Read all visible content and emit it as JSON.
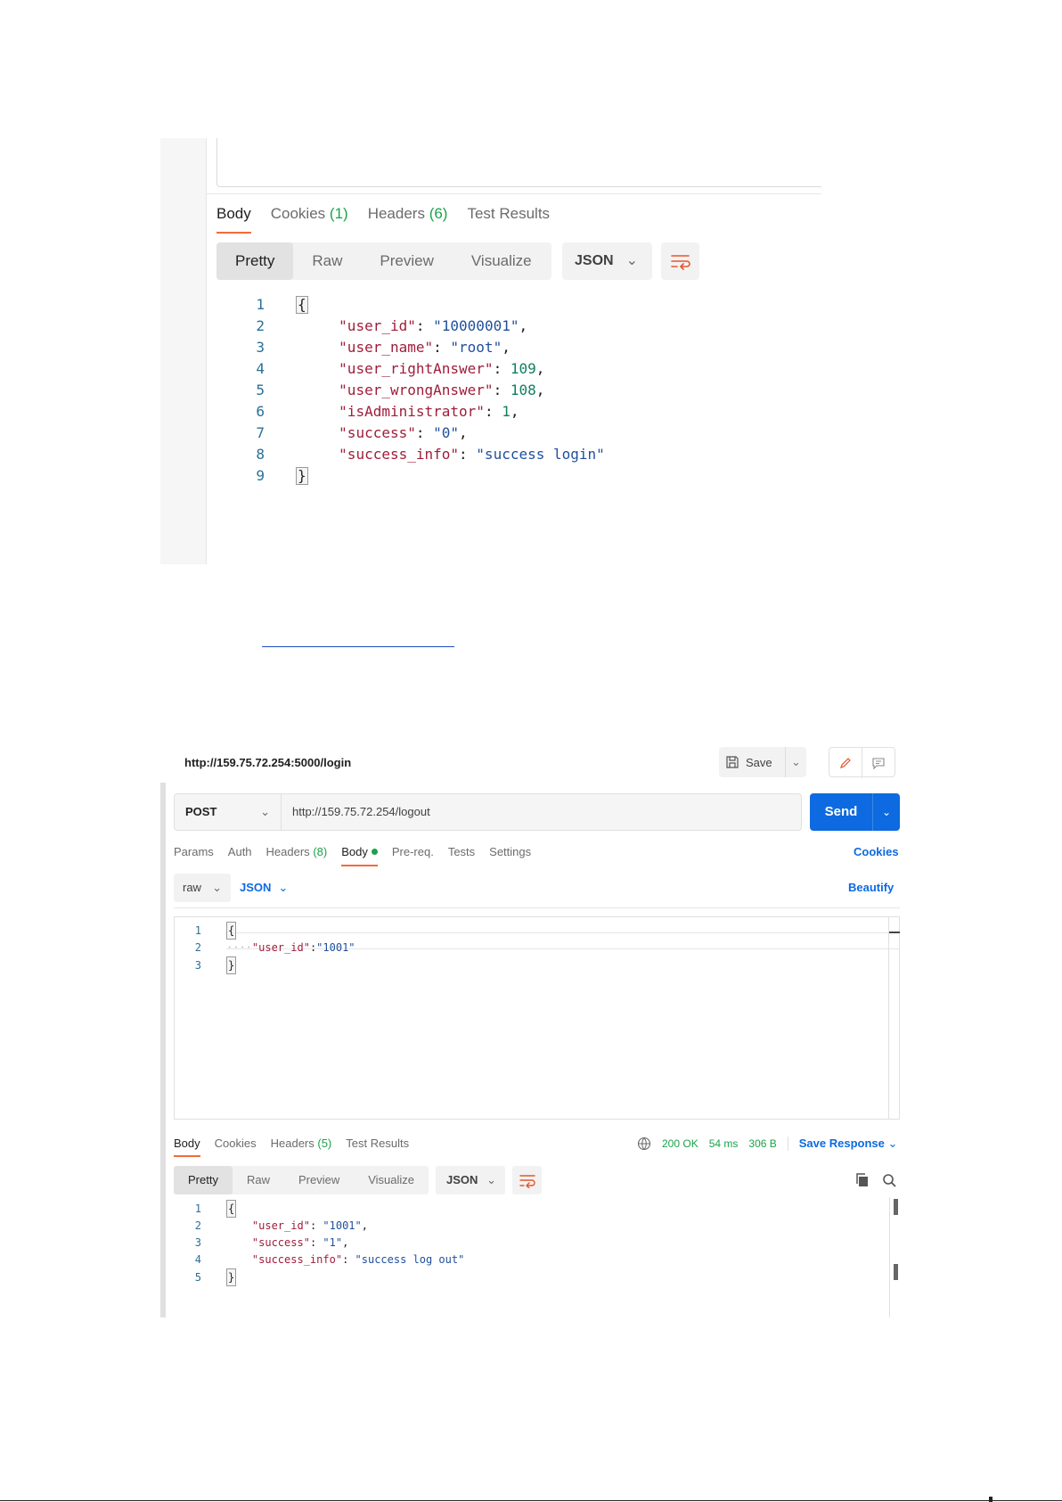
{
  "shot1": {
    "tabs": [
      {
        "label": "Body"
      },
      {
        "label": "Cookies",
        "count": "(1)"
      },
      {
        "label": "Headers",
        "count": "(6)"
      },
      {
        "label": "Test Results"
      }
    ],
    "view_options": [
      "Pretty",
      "Raw",
      "Preview",
      "Visualize"
    ],
    "format": "JSON",
    "code": [
      {
        "ln": "1",
        "brace": "{"
      },
      {
        "ln": "2",
        "key": "\"user_id\"",
        "val": "\"10000001\"",
        "type": "str",
        "end": ","
      },
      {
        "ln": "3",
        "key": "\"user_name\"",
        "val": "\"root\"",
        "type": "str",
        "end": ","
      },
      {
        "ln": "4",
        "key": "\"user_rightAnswer\"",
        "val": "109",
        "type": "num",
        "end": ","
      },
      {
        "ln": "5",
        "key": "\"user_wrongAnswer\"",
        "val": "108",
        "type": "num",
        "end": ","
      },
      {
        "ln": "6",
        "key": "\"isAdministrator\"",
        "val": "1",
        "type": "num",
        "end": ","
      },
      {
        "ln": "7",
        "key": "\"success\"",
        "val": "\"0\"",
        "type": "str",
        "end": ","
      },
      {
        "ln": "8",
        "key": "\"success_info\"",
        "val": "\"success login\"",
        "type": "str",
        "end": ""
      },
      {
        "ln": "9",
        "brace": "}"
      }
    ]
  },
  "shot2": {
    "title_url": "http://159.75.72.254:5000/login",
    "save_label": "Save",
    "method": "POST",
    "url": "http://159.75.72.254/logout",
    "send_label": "Send",
    "request_tabs": [
      {
        "label": "Params"
      },
      {
        "label": "Auth"
      },
      {
        "label": "Headers",
        "count": "(8)"
      },
      {
        "label": "Body"
      },
      {
        "label": "Pre-req."
      },
      {
        "label": "Tests"
      },
      {
        "label": "Settings"
      }
    ],
    "cookies_link": "Cookies",
    "body_mode": "raw",
    "body_format": "JSON",
    "beautify_label": "Beautify",
    "request_code": [
      {
        "ln": "1",
        "text": "{"
      },
      {
        "ln": "2",
        "ws": "····",
        "key": "\"user_id\"",
        "sep": ":",
        "val": "\"1001\""
      },
      {
        "ln": "3",
        "text": "}"
      }
    ],
    "response_tabs": [
      {
        "label": "Body"
      },
      {
        "label": "Cookies"
      },
      {
        "label": "Headers",
        "count": "(5)"
      },
      {
        "label": "Test Results"
      }
    ],
    "status": {
      "code": "200 OK",
      "time": "54 ms",
      "size": "306 B"
    },
    "save_response_label": "Save Response",
    "view_options": [
      "Pretty",
      "Raw",
      "Preview",
      "Visualize"
    ],
    "format": "JSON",
    "response_code": [
      {
        "ln": "1",
        "text": "{"
      },
      {
        "ln": "2",
        "key": "\"user_id\"",
        "val": "\"1001\"",
        "end": ","
      },
      {
        "ln": "3",
        "key": "\"success\"",
        "val": "\"1\"",
        "end": ","
      },
      {
        "ln": "4",
        "key": "\"success_info\"",
        "val": "\"success log out\"",
        "end": ""
      },
      {
        "ln": "5",
        "text": "}"
      }
    ]
  },
  "colors": {
    "accent": "#f26b3a",
    "send": "#0d6ae0",
    "success": "#1aa34a"
  }
}
